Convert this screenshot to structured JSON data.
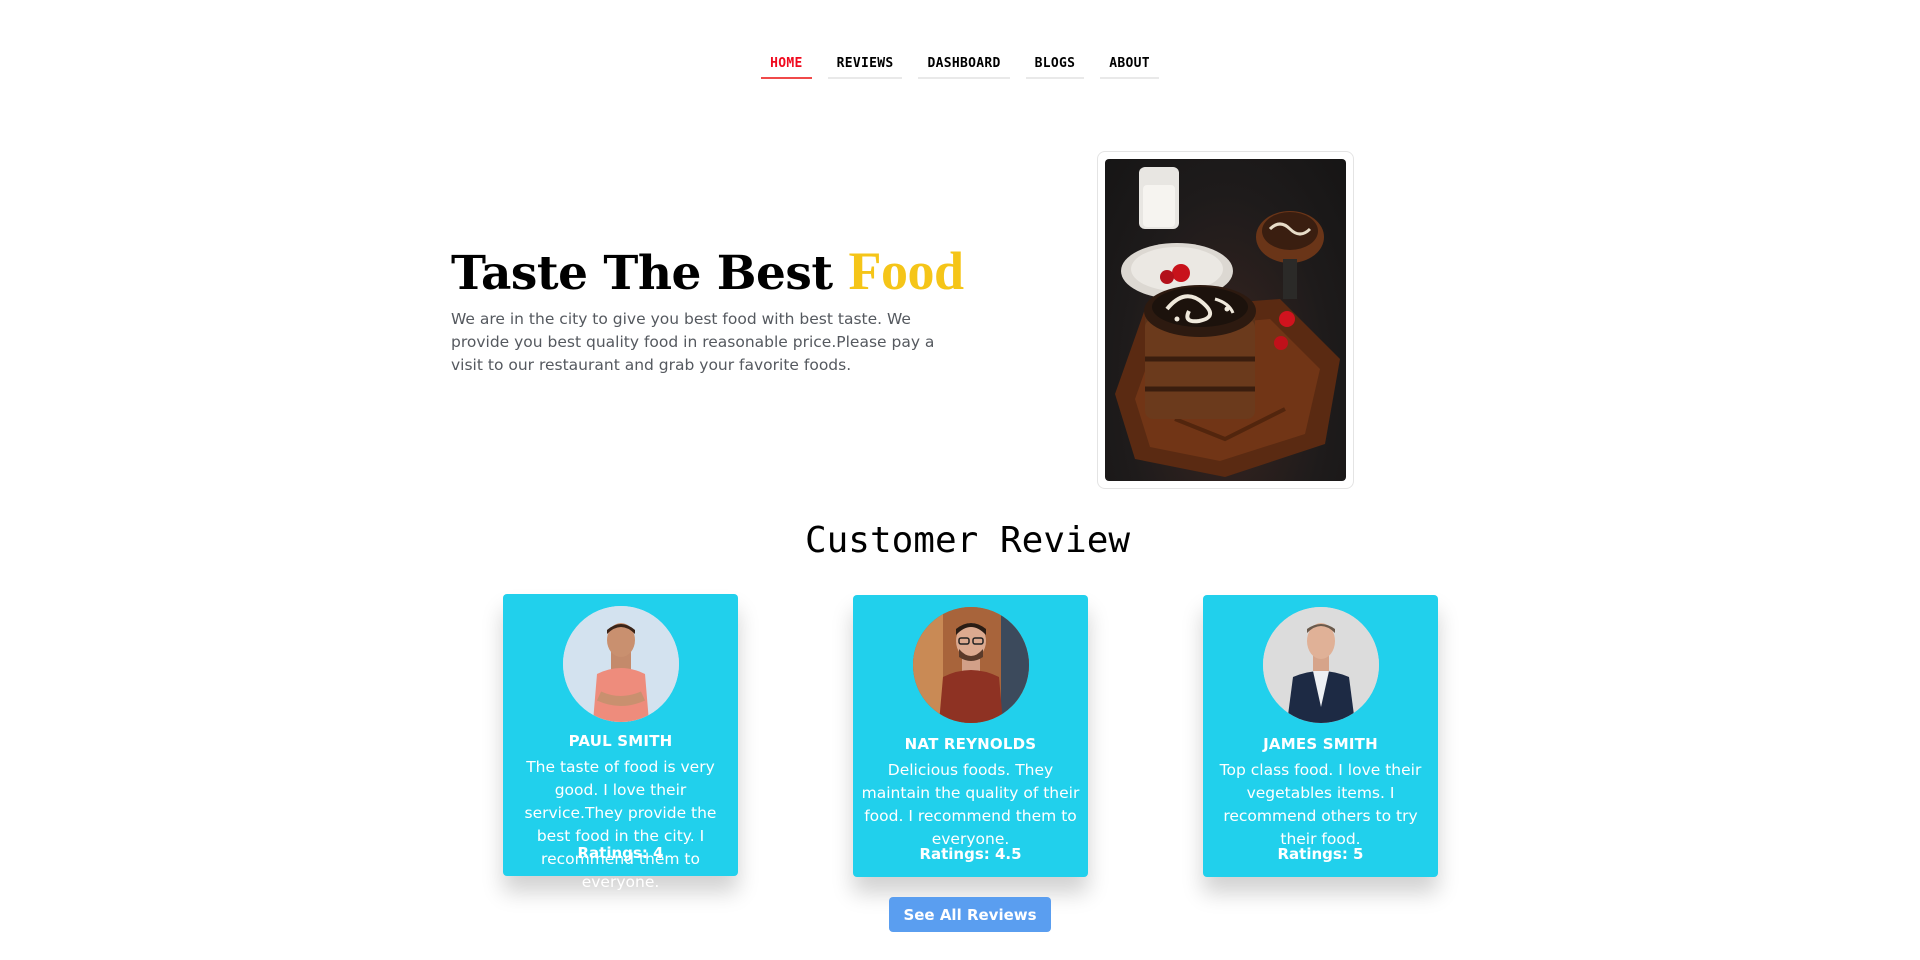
{
  "nav": {
    "items": [
      {
        "label": "HOME",
        "active": true
      },
      {
        "label": "REVIEWS",
        "active": false
      },
      {
        "label": "DASHBOARD",
        "active": false
      },
      {
        "label": "BLOGS",
        "active": false
      },
      {
        "label": "ABOUT",
        "active": false
      }
    ]
  },
  "hero": {
    "title_main": "Taste The Best ",
    "title_accent": "Food",
    "accent_color": "#f5c518",
    "description": "We are in the city to give you best food with best taste. We provide you best quality food in reasonable price.Please pay a visit to our restaurant and grab your favorite foods."
  },
  "reviews": {
    "title": "Customer Review",
    "card_color": "#21d0ec",
    "cards": [
      {
        "name": "PAUL SMITH",
        "text": "The taste of food is very good. I love their service.They provide the best food in the city. I recommend them to everyone.",
        "rating": "Ratings: 4"
      },
      {
        "name": "NAT REYNOLDS",
        "text": "Delicious foods. They maintain the quality of their food. I recommend them to everyone.",
        "rating": "Ratings: 4.5"
      },
      {
        "name": "JAMES SMITH",
        "text": "Top class food. I love their vegetables items. I recommend others to try their food.",
        "rating": "Ratings: 5"
      }
    ],
    "see_all_label": "See All Reviews",
    "see_all_color": "#5a9ef0"
  }
}
